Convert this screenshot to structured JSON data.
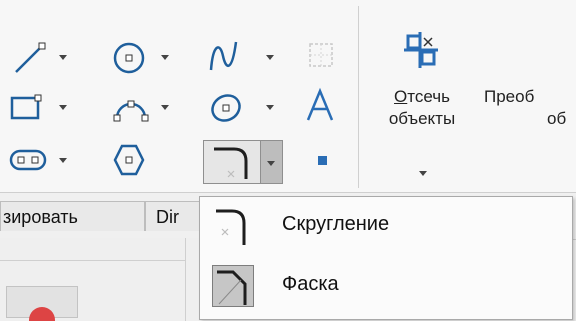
{
  "ribbon": {
    "group_label": {
      "line1_first": "О",
      "line1_rest": "тсечь",
      "line2": "объекты"
    },
    "next_label": {
      "line1": "Преоб",
      "line2": "об"
    },
    "tools": [
      {
        "name": "line-icon"
      },
      {
        "name": "circle-icon"
      },
      {
        "name": "spline-icon"
      },
      {
        "name": "grid-icon"
      },
      {
        "name": "rectangle-icon"
      },
      {
        "name": "arc-icon"
      },
      {
        "name": "ellipse-icon"
      },
      {
        "name": "text-icon"
      },
      {
        "name": "slot-icon"
      },
      {
        "name": "polygon-icon"
      },
      {
        "name": "fillet-icon"
      },
      {
        "name": "point-icon"
      }
    ]
  },
  "tabs": [
    {
      "label": "зировать"
    },
    {
      "label": "Dir"
    }
  ],
  "dropdown": {
    "items": [
      {
        "label": "Скругление",
        "icon": "fillet-icon"
      },
      {
        "label": "Фаска",
        "icon": "chamfer-icon"
      }
    ]
  },
  "colors": {
    "icon_blue": "#1f5f9c",
    "accent_blue": "#2a6db5"
  }
}
